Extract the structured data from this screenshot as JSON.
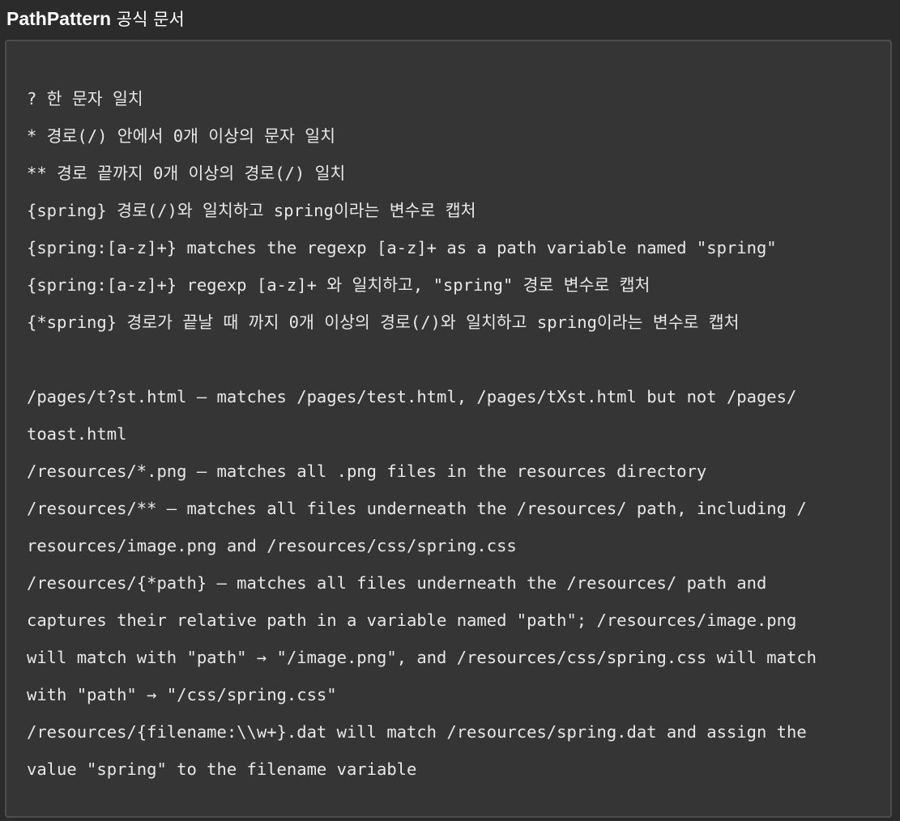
{
  "header": {
    "brand": "PathPattern",
    "title_rest": " 공식 문서"
  },
  "code": {
    "lines": [
      "? 한 문자 일치",
      "* 경로(/) 안에서 0개 이상의 문자 일치",
      "** 경로 끝까지 0개 이상의 경로(/) 일치",
      "{spring} 경로(/)와 일치하고 spring이라는 변수로 캡처",
      "{spring:[a-z]+} matches the regexp [a-z]+ as a path variable named \"spring\"",
      "{spring:[a-z]+} regexp [a-z]+ 와 일치하고, \"spring\" 경로 변수로 캡처",
      "{*spring} 경로가 끝날 때 까지 0개 이상의 경로(/)와 일치하고 spring이라는 변수로 캡처",
      "",
      "/pages/t?st.html — matches /pages/test.html, /pages/tXst.html but not /pages/",
      "toast.html",
      "/resources/*.png — matches all .png files in the resources directory",
      "/resources/** — matches all files underneath the /resources/ path, including /",
      "resources/image.png and /resources/css/spring.css",
      "/resources/{*path} — matches all files underneath the /resources/ path and",
      "captures their relative path in a variable named \"path\"; /resources/image.png",
      "will match with \"path\" → \"/image.png\", and /resources/css/spring.css will match",
      "with \"path\" → \"/css/spring.css\"",
      "/resources/{filename:\\\\w+}.dat will match /resources/spring.dat and assign the",
      "value \"spring\" to the filename variable"
    ]
  }
}
